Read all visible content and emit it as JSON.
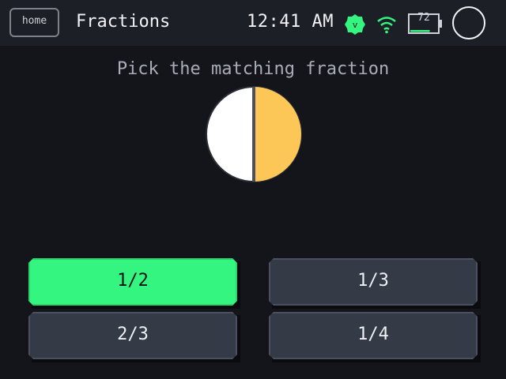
{
  "header": {
    "home_label": "home",
    "title": "Fractions",
    "time": "12:41 AM",
    "badge_letter": "v",
    "battery_level": "72",
    "accent": "#33f57f"
  },
  "quiz": {
    "prompt": "Pick the matching fraction",
    "pie_filled_fraction": 0.5,
    "pie_fill_color": "#fcc756",
    "pie_empty_color": "#ffffff",
    "answers": [
      {
        "label": "1/2",
        "state": "correct"
      },
      {
        "label": "1/3",
        "state": "default"
      },
      {
        "label": "2/3",
        "state": "default"
      },
      {
        "label": "1/4",
        "state": "default"
      }
    ]
  },
  "icons": [
    "home-button",
    "verified-badge-icon",
    "wifi-icon",
    "battery-icon",
    "profile-circle-icon",
    "fraction-pie-icon"
  ]
}
